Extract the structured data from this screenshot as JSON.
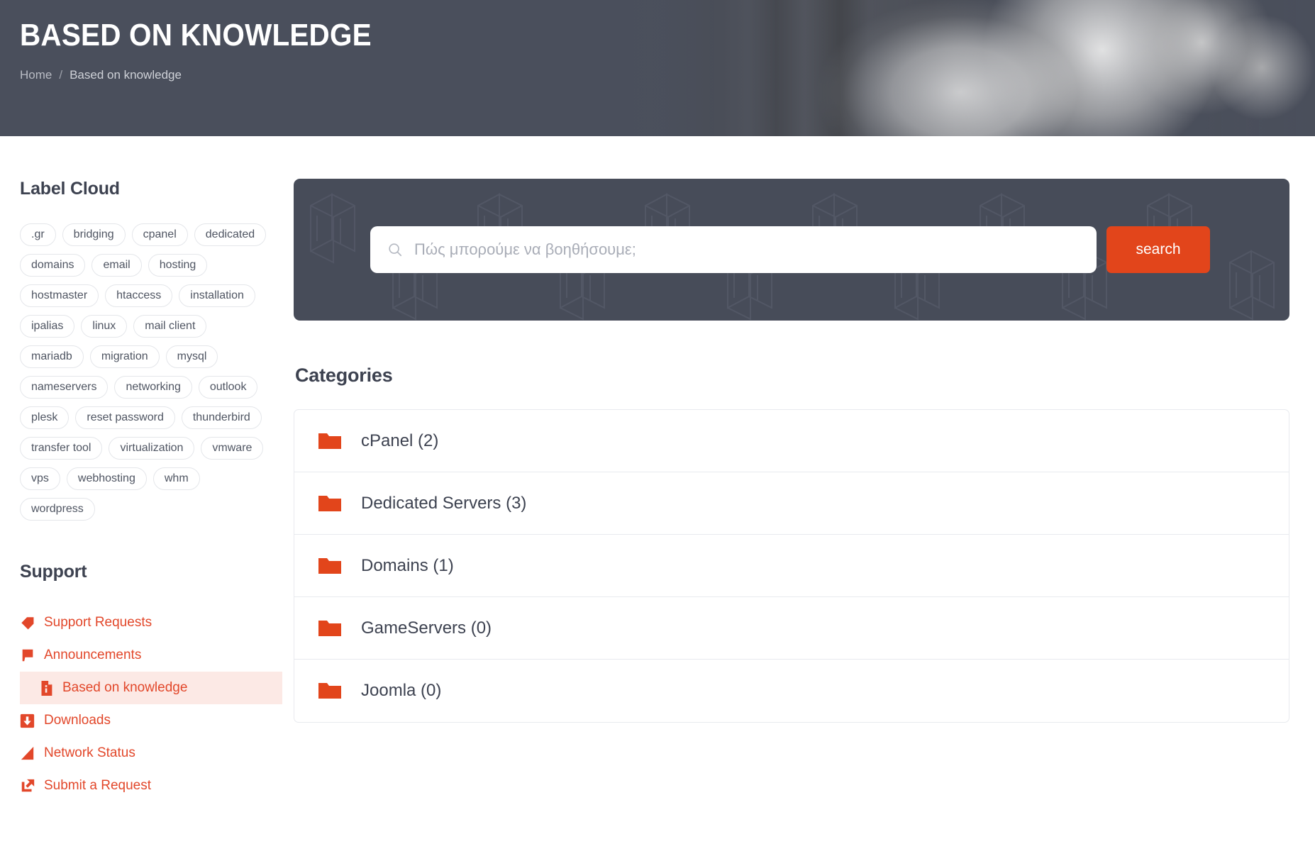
{
  "hero": {
    "title": "BASED ON KNOWLEDGE",
    "breadcrumb": {
      "home": "Home",
      "separator": "/",
      "current": "Based on knowledge"
    }
  },
  "sidebar": {
    "label_cloud": {
      "heading": "Label Cloud",
      "tags": [
        ".gr",
        "bridging",
        "cpanel",
        "dedicated",
        "domains",
        "email",
        "hosting",
        "hostmaster",
        "htaccess",
        "installation",
        "ipalias",
        "linux",
        "mail client",
        "mariadb",
        "migration",
        "mysql",
        "nameservers",
        "networking",
        "outlook",
        "plesk",
        "reset password",
        "thunderbird",
        "transfer tool",
        "virtualization",
        "vmware",
        "vps",
        "webhosting",
        "whm",
        "wordpress"
      ]
    },
    "support": {
      "heading": "Support",
      "items": [
        {
          "label": "Support Requests",
          "icon": "tag-icon",
          "active": false
        },
        {
          "label": "Announcements",
          "icon": "flag-icon",
          "active": false
        },
        {
          "label": "Based on knowledge",
          "icon": "document-icon",
          "active": true
        },
        {
          "label": "Downloads",
          "icon": "download-icon",
          "active": false
        },
        {
          "label": "Network Status",
          "icon": "signal-icon",
          "active": false
        },
        {
          "label": "Submit a Request",
          "icon": "external-link-icon",
          "active": false
        }
      ]
    }
  },
  "search": {
    "placeholder": "Πώς μπορούμε να βοηθήσουμε;",
    "value": "",
    "button_label": "search",
    "icon": "search-icon"
  },
  "categories": {
    "heading": "Categories",
    "items": [
      {
        "label": "cPanel (2)",
        "name": "cPanel",
        "count": 2
      },
      {
        "label": "Dedicated Servers (3)",
        "name": "Dedicated Servers",
        "count": 3
      },
      {
        "label": "Domains (1)",
        "name": "Domains",
        "count": 1
      },
      {
        "label": "GameServers (0)",
        "name": "GameServers",
        "count": 0
      },
      {
        "label": "Joomla (0)",
        "name": "Joomla",
        "count": 0
      }
    ]
  },
  "colors": {
    "accent": "#e2451b",
    "accent_text": "#e2472a",
    "hero_bg": "#4a4f5c",
    "panel_bg": "#474c59",
    "active_row_bg": "#fce9e5",
    "heading_text": "#3d4250",
    "tag_border": "#e4e6ea"
  }
}
